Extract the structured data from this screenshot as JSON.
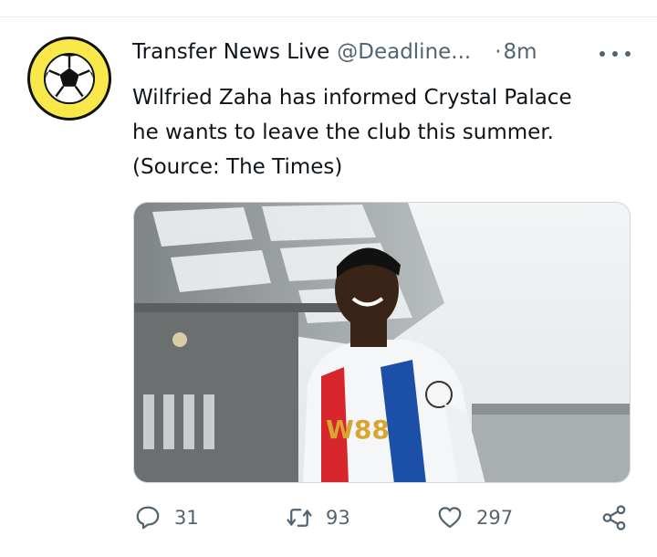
{
  "tweet": {
    "display_name": "Transfer News Live",
    "handle": "@Deadline...",
    "separator": "·",
    "time": "8m",
    "text_lines": [
      "Wilfried Zaha has informed Crystal Palace",
      "he wants to leave the club this summer.",
      "(Source: The Times)"
    ],
    "avatar_icon": "soccer-ball-icon",
    "jersey_text": "W88",
    "actions": {
      "reply_count": "31",
      "retweet_count": "93",
      "like_count": "297"
    },
    "colors": {
      "avatar_bg": "#f8e84a",
      "secondary_text": "#536471",
      "jersey_red": "#d7262c",
      "jersey_blue": "#1c4fa8",
      "sponsor_gold": "#d8a531"
    }
  }
}
